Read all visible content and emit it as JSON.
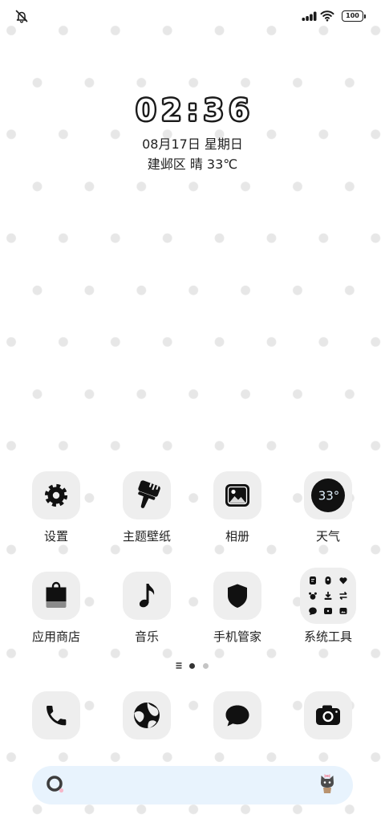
{
  "theme": {
    "background": "#ffffff",
    "dot_color": "#e7e7e7",
    "tile_color": "#eeeeee",
    "icon_color": "#111111",
    "search_bar_color": "#e8f3fd"
  },
  "status_bar": {
    "left_icon": "bell-off-icon",
    "signal_icon": "signal-icon",
    "wifi_icon": "wifi-icon",
    "battery_text": "100"
  },
  "clock_widget": {
    "time": "02:36",
    "date": "08月17日 星期日",
    "weather": "建邺区 晴 33℃"
  },
  "apps": {
    "row1": [
      {
        "label": "设置",
        "icon": "gear-icon"
      },
      {
        "label": "主题壁纸",
        "icon": "paintbrush-icon"
      },
      {
        "label": "相册",
        "icon": "gallery-icon"
      },
      {
        "label": "天气",
        "icon": "weather-icon",
        "icon_text": "33°"
      }
    ],
    "row2": [
      {
        "label": "应用商店",
        "icon": "shopping-bag-icon"
      },
      {
        "label": "音乐",
        "icon": "music-note-icon"
      },
      {
        "label": "手机管家",
        "icon": "shield-icon"
      },
      {
        "label": "系统工具",
        "icon": "folder-icon",
        "folder_icons": [
          "notes-icon",
          "recorder-icon",
          "heart-icon",
          "paw-icon",
          "download-icon",
          "swap-icon",
          "chat-icon",
          "screen-icon",
          "image-icon"
        ]
      }
    ]
  },
  "page_indicator": {
    "feed_icon": "menu-lines-icon",
    "page_count": 2,
    "active_page": 1
  },
  "dock": [
    {
      "icon": "phone-icon"
    },
    {
      "icon": "browser-globe-icon"
    },
    {
      "icon": "message-bubble-icon"
    },
    {
      "icon": "camera-icon"
    }
  ],
  "search_bar": {
    "left_icon": "search-ring-icon",
    "right_icon": "mascot-icon"
  }
}
